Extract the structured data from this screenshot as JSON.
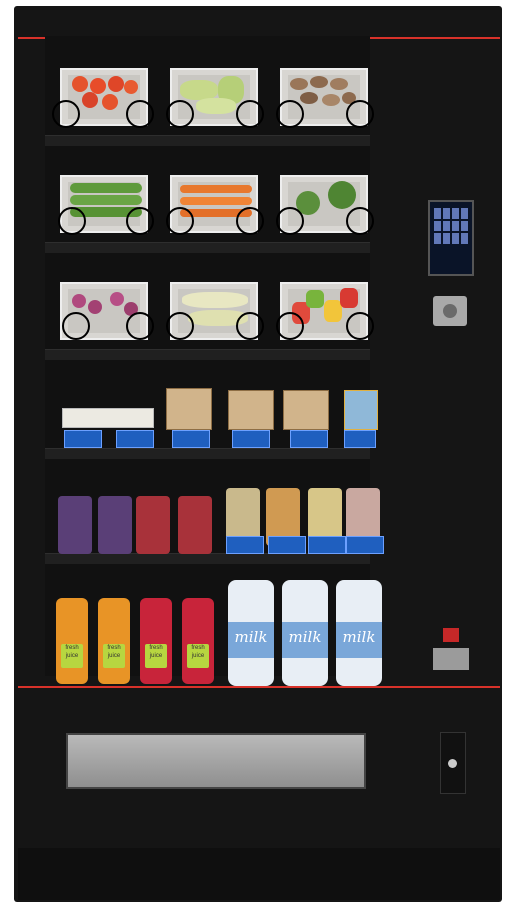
{
  "machine": {
    "kind": "fresh food vending machine",
    "accent_color": "#d8322a",
    "body_color": "#151515"
  },
  "products": {
    "milk_label": "milk",
    "juice_label": "fresh juice"
  },
  "icons": [
    "coin-slot-icon",
    "key-lock-icon",
    "brand-logo-icon"
  ]
}
